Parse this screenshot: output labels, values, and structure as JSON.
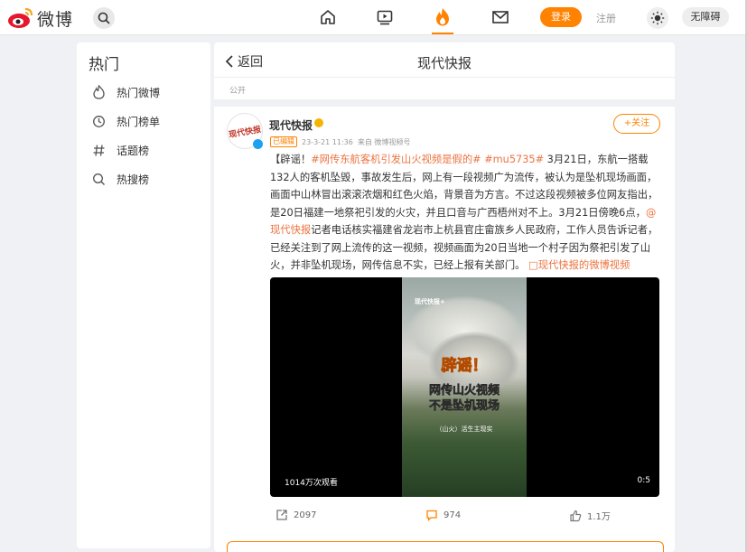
{
  "header": {
    "logo_text": "微博",
    "nav_icons": [
      "home-icon",
      "video-icon",
      "hot-fire-icon",
      "mail-icon"
    ],
    "active_nav": "hot-fire-icon",
    "login_label": "登录",
    "register_label": "注册",
    "accessibility_label": "无障碍"
  },
  "sidebar": {
    "title": "热门",
    "items": [
      {
        "label": "热门微博",
        "icon": "fire-outline-icon"
      },
      {
        "label": "热门榜单",
        "icon": "clock-icon"
      },
      {
        "label": "话题榜",
        "icon": "hashtag-icon"
      },
      {
        "label": "热搜榜",
        "icon": "search-icon"
      }
    ]
  },
  "main": {
    "back_label": "返回",
    "title": "现代快报",
    "visibility": "公开",
    "post": {
      "username": "现代快报",
      "avatar_text": "现代快报",
      "follow_label": "+关注",
      "edited_tag": "已编辑",
      "timestamp": "23-3-21 11:36",
      "source": "来自 微博视频号",
      "text": {
        "p1": "【辟谣！",
        "topic1": "#网传东航客机引发山火视频是假的#",
        "p2": " ",
        "topic2": "#mu5735#",
        "p3": " 3月21日，东航一搭载132人的客机坠毁，事故发生后，网上有一段视频广为流传，被认为是坠机现场画面，画面中山林冒出滚滚浓烟和红色火焰，背景音为方言。不过这段视频被多位网友指出，是20日福建一地祭祀引发的火灾，并且口音与广西梧州对不上。3月21日傍晚6点，",
        "mention": "@现代快报",
        "p4": "记者电话核实福建省龙岩市上杭县官庄畲族乡人民政府，工作人员告诉记者，已经关注到了网上流传的这一视频，视频画面为20日当地一个村子因为祭祀引发了山火，并非坠机现场，网传信息不实，已经上报有关部门。",
        "video_link": "□现代快报的微博视频"
      },
      "video": {
        "frame_logo": "现代快报+",
        "frame_title": "辟谣！",
        "frame_sub1": "网传山火视频",
        "frame_sub2": "不是坠机现场",
        "frame_caption": "（山火）活生主现实",
        "view_count": "1014万次观看",
        "duration": "0:5"
      },
      "actions": {
        "repost_count": "2097",
        "comment_count": "974",
        "like_count": "1.1万"
      }
    }
  },
  "colors": {
    "accent": "#ff8200",
    "link": "#eb7340",
    "page_bg": "#f0f1f4"
  }
}
